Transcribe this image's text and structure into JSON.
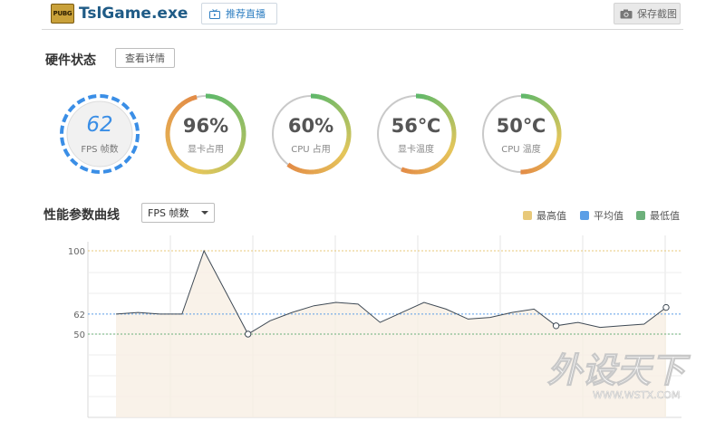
{
  "header": {
    "logo_text": "PUBG",
    "app_title": "TslGame.exe",
    "live_button": "推荐直播",
    "save_button": "保存截图"
  },
  "hardware": {
    "title": "硬件状态",
    "detail_button": "查看详情",
    "gauges": [
      {
        "id": "fps",
        "value": "62",
        "label": "FPS 帧数"
      },
      {
        "id": "gpu_usage",
        "value": "96%",
        "label": "显卡占用",
        "fraction": 0.96
      },
      {
        "id": "cpu_usage",
        "value": "60%",
        "label": "CPU 占用",
        "fraction": 0.6
      },
      {
        "id": "gpu_temp",
        "value": "56℃",
        "label": "显卡温度",
        "fraction": 0.56
      },
      {
        "id": "cpu_temp",
        "value": "50℃",
        "label": "CPU 温度",
        "fraction": 0.5
      }
    ]
  },
  "performance": {
    "title": "性能参数曲线",
    "select_value": "FPS 帧数",
    "legend": [
      {
        "label": "最高值",
        "color": "#e8c97a"
      },
      {
        "label": "平均值",
        "color": "#5b9ee6"
      },
      {
        "label": "最低值",
        "color": "#6cb07a"
      }
    ]
  },
  "chart_data": {
    "type": "area",
    "ylim": [
      0,
      110
    ],
    "reference_lines": {
      "max": 100,
      "avg": 62,
      "min": 50
    },
    "y_tick_labels": [
      "100",
      "62",
      "50"
    ],
    "values": [
      62,
      63,
      62,
      62,
      100,
      75,
      50,
      58,
      63,
      67,
      69,
      68,
      57,
      63,
      69,
      65,
      59,
      60,
      63,
      65,
      55,
      57,
      54,
      55,
      56,
      66
    ],
    "markers": [
      6,
      20,
      25
    ]
  },
  "watermark": {
    "text": "外设天下",
    "sub": "WWW.WSTX.COM"
  }
}
